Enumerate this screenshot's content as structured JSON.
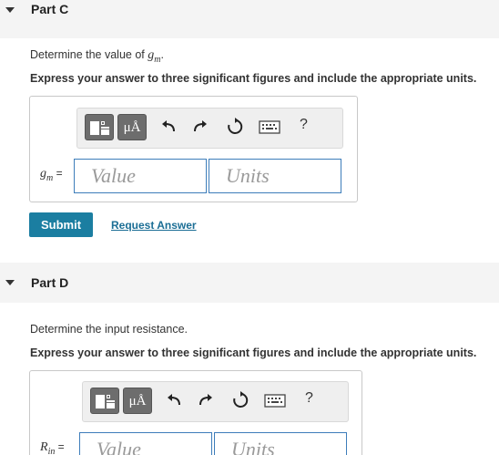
{
  "partC": {
    "title": "Part C",
    "prompt_text": "Determine the value of ",
    "prompt_var_base": "g",
    "prompt_var_sub": "m",
    "prompt_end": ".",
    "instruction": "Express your answer to three significant figures and include the appropriate units.",
    "var_base": "g",
    "var_sub": "m",
    "eq": " =",
    "value_placeholder": "Value",
    "units_placeholder": "Units",
    "submit_label": "Submit",
    "request_label": "Request Answer"
  },
  "partD": {
    "title": "Part D",
    "prompt_text": "Determine the input resistance.",
    "instruction": "Express your answer to three significant figures and include the appropriate units.",
    "var_base": "R",
    "var_sub": "in",
    "eq": " =",
    "value_placeholder": "Value",
    "units_placeholder": "Units"
  },
  "toolbar": {
    "units_label": "μÅ",
    "help_label": "?",
    "icons": [
      "templates-icon",
      "units-icon",
      "undo-icon",
      "redo-icon",
      "reset-icon",
      "keyboard-icon",
      "help-icon"
    ]
  }
}
